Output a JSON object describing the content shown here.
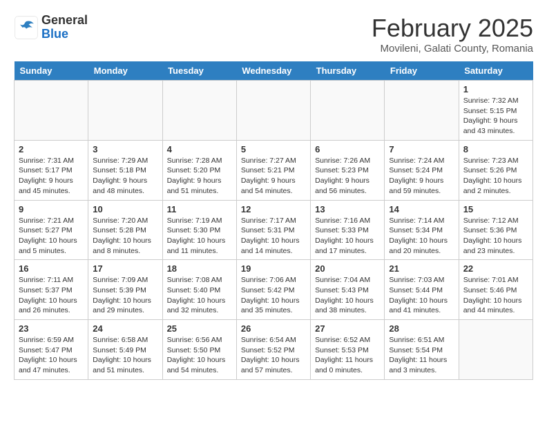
{
  "header": {
    "logo_general": "General",
    "logo_blue": "Blue",
    "month_title": "February 2025",
    "location": "Movileni, Galati County, Romania"
  },
  "weekdays": [
    "Sunday",
    "Monday",
    "Tuesday",
    "Wednesday",
    "Thursday",
    "Friday",
    "Saturday"
  ],
  "weeks": [
    [
      {
        "day": "",
        "info": ""
      },
      {
        "day": "",
        "info": ""
      },
      {
        "day": "",
        "info": ""
      },
      {
        "day": "",
        "info": ""
      },
      {
        "day": "",
        "info": ""
      },
      {
        "day": "",
        "info": ""
      },
      {
        "day": "1",
        "info": "Sunrise: 7:32 AM\nSunset: 5:15 PM\nDaylight: 9 hours and 43 minutes."
      }
    ],
    [
      {
        "day": "2",
        "info": "Sunrise: 7:31 AM\nSunset: 5:17 PM\nDaylight: 9 hours and 45 minutes."
      },
      {
        "day": "3",
        "info": "Sunrise: 7:29 AM\nSunset: 5:18 PM\nDaylight: 9 hours and 48 minutes."
      },
      {
        "day": "4",
        "info": "Sunrise: 7:28 AM\nSunset: 5:20 PM\nDaylight: 9 hours and 51 minutes."
      },
      {
        "day": "5",
        "info": "Sunrise: 7:27 AM\nSunset: 5:21 PM\nDaylight: 9 hours and 54 minutes."
      },
      {
        "day": "6",
        "info": "Sunrise: 7:26 AM\nSunset: 5:23 PM\nDaylight: 9 hours and 56 minutes."
      },
      {
        "day": "7",
        "info": "Sunrise: 7:24 AM\nSunset: 5:24 PM\nDaylight: 9 hours and 59 minutes."
      },
      {
        "day": "8",
        "info": "Sunrise: 7:23 AM\nSunset: 5:26 PM\nDaylight: 10 hours and 2 minutes."
      }
    ],
    [
      {
        "day": "9",
        "info": "Sunrise: 7:21 AM\nSunset: 5:27 PM\nDaylight: 10 hours and 5 minutes."
      },
      {
        "day": "10",
        "info": "Sunrise: 7:20 AM\nSunset: 5:28 PM\nDaylight: 10 hours and 8 minutes."
      },
      {
        "day": "11",
        "info": "Sunrise: 7:19 AM\nSunset: 5:30 PM\nDaylight: 10 hours and 11 minutes."
      },
      {
        "day": "12",
        "info": "Sunrise: 7:17 AM\nSunset: 5:31 PM\nDaylight: 10 hours and 14 minutes."
      },
      {
        "day": "13",
        "info": "Sunrise: 7:16 AM\nSunset: 5:33 PM\nDaylight: 10 hours and 17 minutes."
      },
      {
        "day": "14",
        "info": "Sunrise: 7:14 AM\nSunset: 5:34 PM\nDaylight: 10 hours and 20 minutes."
      },
      {
        "day": "15",
        "info": "Sunrise: 7:12 AM\nSunset: 5:36 PM\nDaylight: 10 hours and 23 minutes."
      }
    ],
    [
      {
        "day": "16",
        "info": "Sunrise: 7:11 AM\nSunset: 5:37 PM\nDaylight: 10 hours and 26 minutes."
      },
      {
        "day": "17",
        "info": "Sunrise: 7:09 AM\nSunset: 5:39 PM\nDaylight: 10 hours and 29 minutes."
      },
      {
        "day": "18",
        "info": "Sunrise: 7:08 AM\nSunset: 5:40 PM\nDaylight: 10 hours and 32 minutes."
      },
      {
        "day": "19",
        "info": "Sunrise: 7:06 AM\nSunset: 5:42 PM\nDaylight: 10 hours and 35 minutes."
      },
      {
        "day": "20",
        "info": "Sunrise: 7:04 AM\nSunset: 5:43 PM\nDaylight: 10 hours and 38 minutes."
      },
      {
        "day": "21",
        "info": "Sunrise: 7:03 AM\nSunset: 5:44 PM\nDaylight: 10 hours and 41 minutes."
      },
      {
        "day": "22",
        "info": "Sunrise: 7:01 AM\nSunset: 5:46 PM\nDaylight: 10 hours and 44 minutes."
      }
    ],
    [
      {
        "day": "23",
        "info": "Sunrise: 6:59 AM\nSunset: 5:47 PM\nDaylight: 10 hours and 47 minutes."
      },
      {
        "day": "24",
        "info": "Sunrise: 6:58 AM\nSunset: 5:49 PM\nDaylight: 10 hours and 51 minutes."
      },
      {
        "day": "25",
        "info": "Sunrise: 6:56 AM\nSunset: 5:50 PM\nDaylight: 10 hours and 54 minutes."
      },
      {
        "day": "26",
        "info": "Sunrise: 6:54 AM\nSunset: 5:52 PM\nDaylight: 10 hours and 57 minutes."
      },
      {
        "day": "27",
        "info": "Sunrise: 6:52 AM\nSunset: 5:53 PM\nDaylight: 11 hours and 0 minutes."
      },
      {
        "day": "28",
        "info": "Sunrise: 6:51 AM\nSunset: 5:54 PM\nDaylight: 11 hours and 3 minutes."
      },
      {
        "day": "",
        "info": ""
      }
    ]
  ]
}
